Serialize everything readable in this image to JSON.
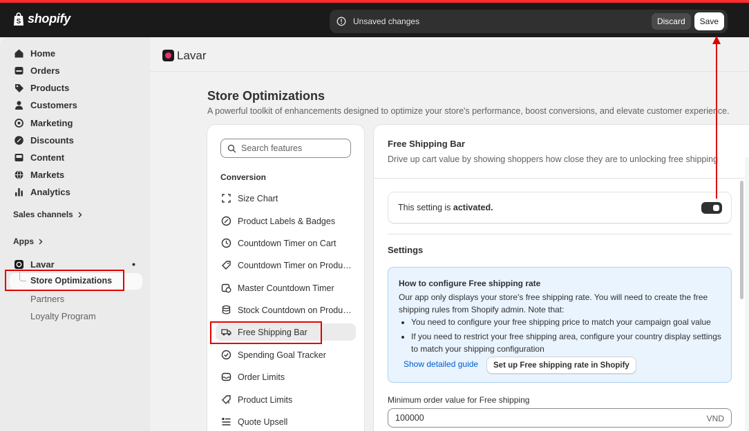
{
  "topbar": {
    "brand": "shopify",
    "unsaved_message": "Unsaved changes",
    "discard_label": "Discard",
    "save_label": "Save"
  },
  "sidebar": {
    "items": [
      {
        "label": "Home",
        "icon": "home-icon"
      },
      {
        "label": "Orders",
        "icon": "orders-icon"
      },
      {
        "label": "Products",
        "icon": "tag-icon"
      },
      {
        "label": "Customers",
        "icon": "person-icon"
      },
      {
        "label": "Marketing",
        "icon": "target-icon"
      },
      {
        "label": "Discounts",
        "icon": "discount-icon"
      },
      {
        "label": "Content",
        "icon": "content-icon"
      },
      {
        "label": "Markets",
        "icon": "globe-icon"
      },
      {
        "label": "Analytics",
        "icon": "bar-chart-icon"
      }
    ],
    "sales_channels": "Sales channels",
    "apps": "Apps",
    "app_name": "Lavar",
    "app_sub_items": [
      "Store Optimizations",
      "Partners",
      "Loyalty Program"
    ]
  },
  "app_header": {
    "title": "Lavar"
  },
  "page": {
    "title": "Store Optimizations",
    "subtitle": "A powerful toolkit of enhancements designed to optimize your store's performance, boost conversions, and elevate customer experience."
  },
  "features": {
    "search_placeholder": "Search features",
    "group": "Conversion",
    "items": [
      {
        "label": "Size Chart",
        "icon": "size-chart-icon"
      },
      {
        "label": "Product Labels & Badges",
        "icon": "badge-icon"
      },
      {
        "label": "Countdown Timer on Cart",
        "icon": "clock-icon"
      },
      {
        "label": "Countdown Timer on Product Page",
        "icon": "timer-icon"
      },
      {
        "label": "Master Countdown Timer",
        "icon": "calendar-clock-icon"
      },
      {
        "label": "Stock Countdown on Product Page",
        "icon": "database-icon"
      },
      {
        "label": "Free Shipping Bar",
        "icon": "truck-icon"
      },
      {
        "label": "Spending Goal Tracker",
        "icon": "check-circle-icon"
      },
      {
        "label": "Order Limits",
        "icon": "inbox-icon"
      },
      {
        "label": "Product Limits",
        "icon": "tag-limit-icon"
      },
      {
        "label": "Quote Upsell",
        "icon": "list-icon"
      }
    ]
  },
  "detail": {
    "title": "Free Shipping Bar",
    "subtitle": "Drive up cart value by showing shoppers how close they are to unlocking free shipping",
    "status_prefix": "This setting is ",
    "status_value": "activated.",
    "settings_heading": "Settings",
    "info": {
      "heading": "How to configure Free shipping rate",
      "body": "Our app only displays your store's free shipping rate. You will need to create the free shipping rules from Shopify admin. Note that:",
      "bullets": [
        "You need to configure your free shipping price to match your campaign goal value",
        "If you need to restrict your free shipping area, configure your country display settings to match your shipping configuration"
      ],
      "guide_link": "Show detailed guide",
      "setup_button": "Set up Free shipping rate in Shopify"
    },
    "min_order_label": "Minimum order value for Free shipping",
    "min_order_value": "100000",
    "currency": "VND"
  },
  "colors": {
    "topbar": "#1a1a1a",
    "highlight": "#e00000",
    "link": "#005bd3",
    "info_bg": "#eaf4ff"
  }
}
